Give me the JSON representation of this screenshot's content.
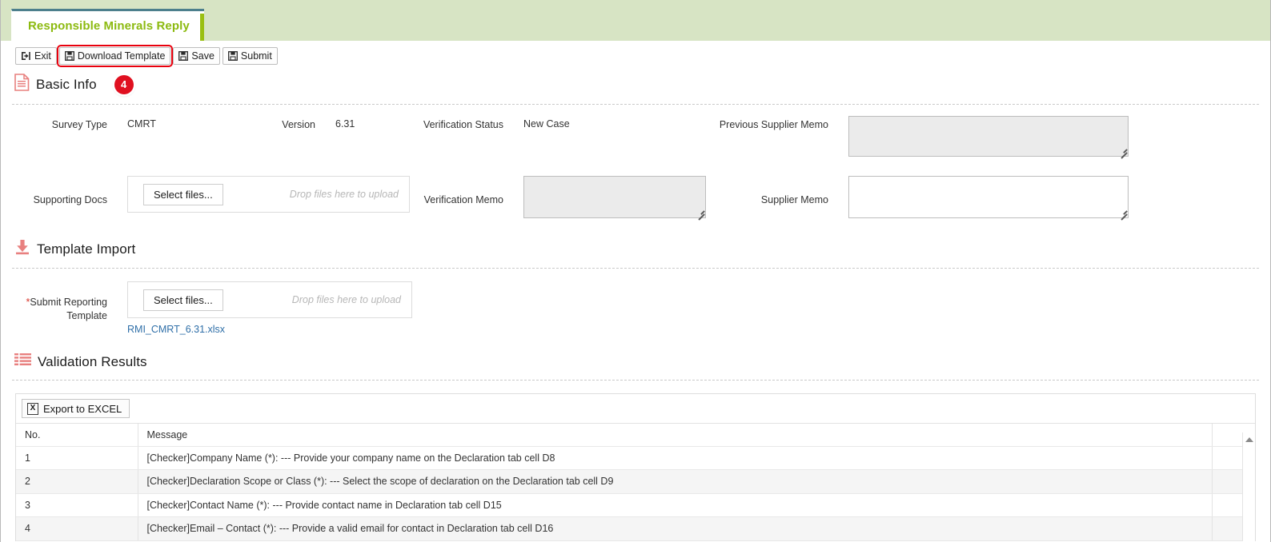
{
  "tab": {
    "label": "Responsible Minerals Reply"
  },
  "colors": {
    "header_band": "#d7e4c4",
    "tab_text": "#8cba10",
    "tab_edge": "#9abf12",
    "tab_top_border": "#4c7f8c",
    "highlight_outline": "#e8000d",
    "badge_bg": "#e01020",
    "section_icon": "#e8807f",
    "file_link": "#2f6fa8"
  },
  "toolbar": {
    "buttons": [
      {
        "label": "Exit",
        "icon": "sign-out-icon",
        "highlighted": false
      },
      {
        "label": "Download Template",
        "icon": "save-icon",
        "highlighted": true
      },
      {
        "label": "Save",
        "icon": "save-icon",
        "highlighted": false
      },
      {
        "label": "Submit",
        "icon": "save-icon",
        "highlighted": false
      }
    ]
  },
  "basic_info": {
    "title": "Basic Info",
    "icon": "document-icon",
    "badge": "4",
    "survey_type_label": "Survey Type",
    "survey_type_value": "CMRT",
    "version_label": "Version",
    "version_value": "6.31",
    "verification_status_label": "Verification Status",
    "verification_status_value": "New Case",
    "previous_supplier_memo_label": "Previous Supplier Memo",
    "previous_supplier_memo_value": "",
    "supporting_docs_label": "Supporting Docs",
    "verification_memo_label": "Verification Memo",
    "verification_memo_value": "",
    "supplier_memo_label": "Supplier Memo",
    "supplier_memo_value": "",
    "upload": {
      "select_files_label": "Select files...",
      "drop_hint": "Drop files here to upload"
    }
  },
  "template_import": {
    "title": "Template Import",
    "icon": "download-icon",
    "field_label_line1": "*Submit Reporting",
    "field_label_line2": "Template",
    "required_marker": "*",
    "field_label_text": "Submit Reporting",
    "upload": {
      "select_files_label": "Select files...",
      "drop_hint": "Drop files here to upload"
    },
    "uploaded_file": "RMI_CMRT_6.31.xlsx"
  },
  "validation_results": {
    "title": "Validation Results",
    "icon": "list-icon",
    "export_button_label": "Export to EXCEL",
    "export_button_icon": "excel-icon",
    "scroll_up_icon": "triangle-up-icon",
    "table": {
      "columns": [
        "No.",
        "Message",
        ""
      ],
      "rows": [
        {
          "no": "1",
          "message": "[Checker]Company Name (*): --- Provide your company name on the Declaration tab cell D8"
        },
        {
          "no": "2",
          "message": "[Checker]Declaration Scope or Class (*): --- Select the scope of declaration on the Declaration tab cell D9"
        },
        {
          "no": "3",
          "message": "[Checker]Contact Name (*): --- Provide contact name in Declaration tab cell D15"
        },
        {
          "no": "4",
          "message": "[Checker]Email – Contact (*): --- Provide a valid email for contact in Declaration tab cell D16"
        }
      ]
    }
  }
}
